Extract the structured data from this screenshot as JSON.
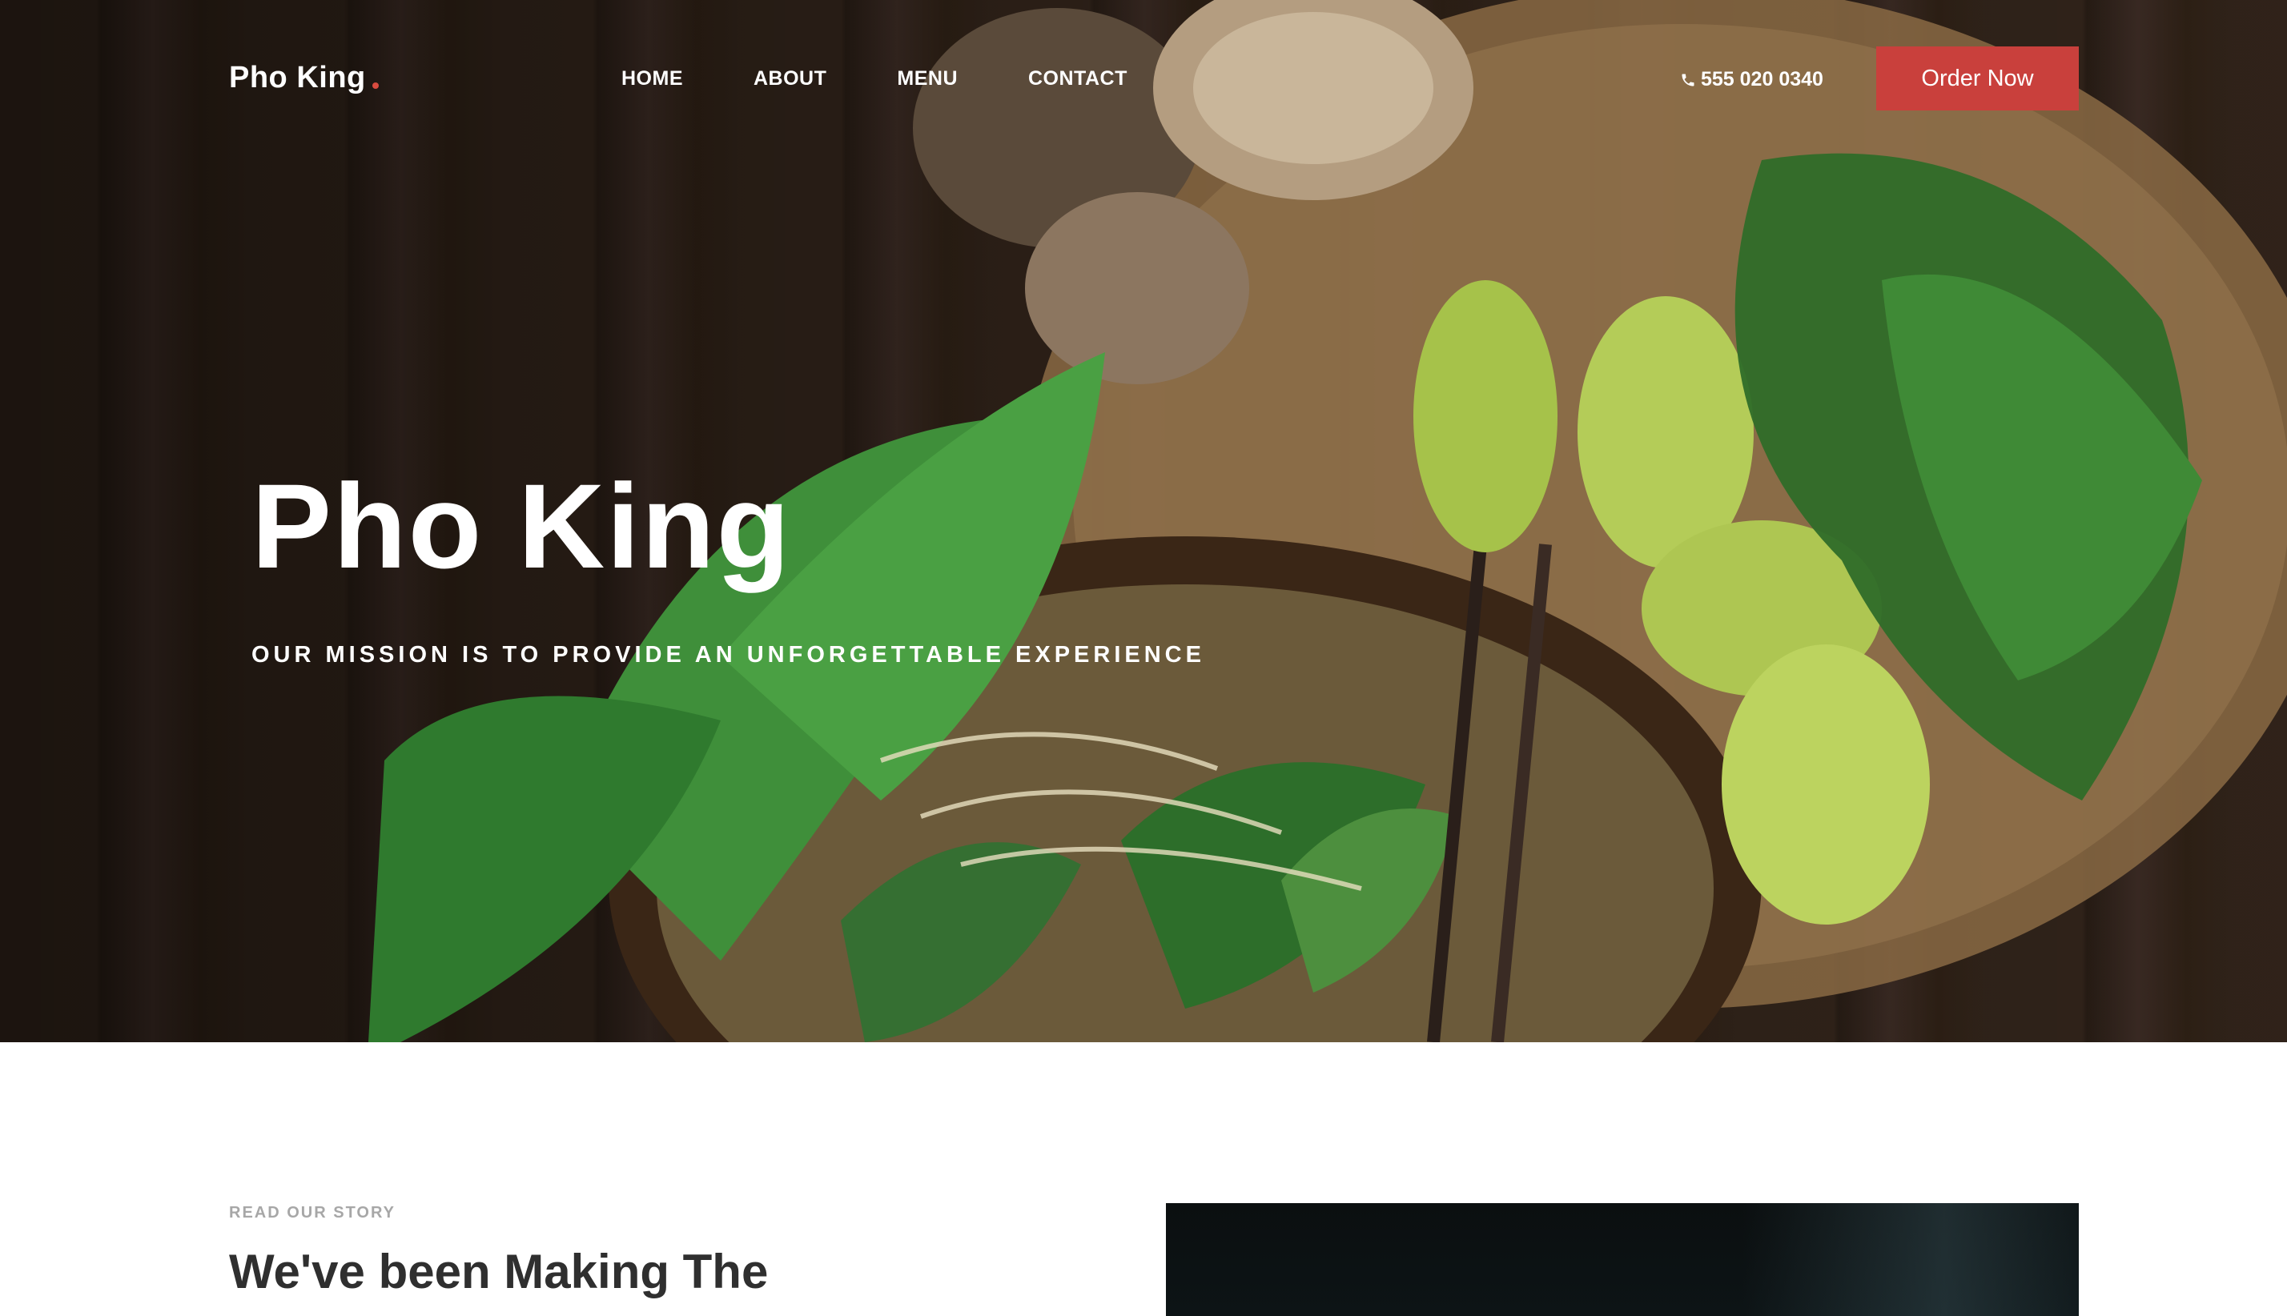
{
  "nav": {
    "brand": "Pho King",
    "links": [
      "HOME",
      "ABOUT",
      "MENU",
      "CONTACT"
    ],
    "phone": "555 020 0340",
    "order_label": "Order Now"
  },
  "hero": {
    "title": "Pho King",
    "subtitle": "OUR MISSION IS TO PROVIDE AN UNFORGETTABLE EXPERIENCE"
  },
  "story": {
    "eyebrow": "READ OUR STORY",
    "heading": "We've been Making The"
  },
  "colors": {
    "accent": "#c9403c",
    "brand_dot": "#d84b3f"
  },
  "icons": {
    "phone": "phone-icon"
  }
}
